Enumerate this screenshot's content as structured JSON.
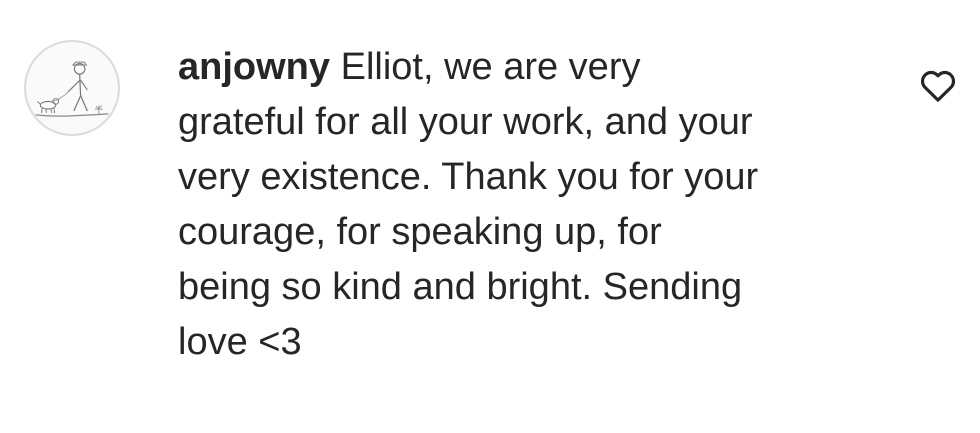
{
  "comment": {
    "username": "anjowny",
    "lines": [
      "Elliot, we are very",
      "grateful for all your work, and your",
      "very existence. Thank you for your",
      "courage, for speaking up, for",
      "being so kind and bright. Sending",
      "love <3"
    ],
    "avatar_icon": "stick-figure-walking-dog-drawing",
    "like_icon": "heart-outline-icon"
  }
}
